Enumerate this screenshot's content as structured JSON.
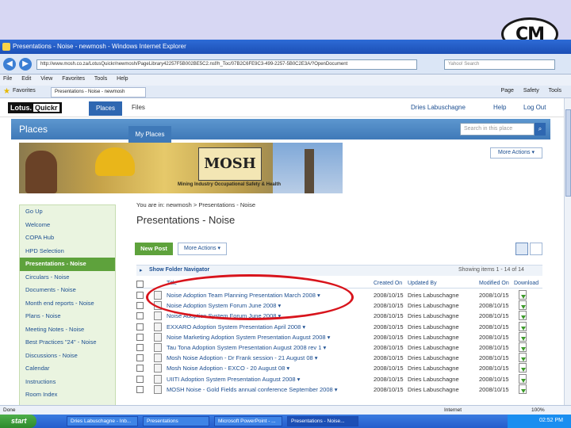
{
  "logo_text": "CM",
  "browser": {
    "title": "Presentations - Noise - newmosh - Windows Internet Explorer",
    "address": "http://www.mosh.co.za/LotusQuickr/newmosh/PageLibrary42257F5B002BE5C2.nsf/h_Toc/07B2C6FE9C3-499-2257-5B0C2E3A/?OpenDocument",
    "search_placeholder": "Yahoo! Search",
    "menu": [
      "File",
      "Edit",
      "View",
      "Favorites",
      "Tools",
      "Help"
    ],
    "favorites_label": "Favorites",
    "tab_label": "Presentations - Noise - newmosh",
    "tools": [
      "Page",
      "Safety",
      "Tools"
    ]
  },
  "quickr": {
    "logo_lotus": "Lotus.",
    "logo_quickr": "Quickr",
    "tab_places": "Places",
    "tab_files": "Files",
    "user": "Dries Labuschagne",
    "help": "Help",
    "logout": "Log Out",
    "places_title": "Places",
    "search_placeholder": "Search in this place",
    "myplaces_tab": "My Places",
    "banner_logo": "MOSH",
    "banner_caption": "Mining Industry Occupational Safety & Health",
    "more_actions_top": "More Actions ▾"
  },
  "sidebar": {
    "items": [
      {
        "label": "Go Up"
      },
      {
        "label": "Welcome"
      },
      {
        "label": "COPA Hub"
      },
      {
        "label": "HPD Selection"
      },
      {
        "label": "Presentations - Noise",
        "active": true
      },
      {
        "label": "Circulars - Noise"
      },
      {
        "label": "Documents - Noise"
      },
      {
        "label": "Month end reports - Noise"
      },
      {
        "label": "Plans - Noise"
      },
      {
        "label": "Meeting Notes - Noise"
      },
      {
        "label": "Best Practices \"24\" - Noise"
      },
      {
        "label": "Discussions - Noise"
      },
      {
        "label": "Calendar"
      },
      {
        "label": "Instructions"
      },
      {
        "label": "Room Index"
      }
    ]
  },
  "main": {
    "breadcrumb": "You are in: newmosh > Presentations - Noise",
    "title": "Presentations - Noise",
    "new_post": "New Post",
    "more_actions": "More Actions ▾",
    "folder_nav": "Show Folder Navigator",
    "showing_label": "Showing items",
    "showing_range": "1 - 14",
    "showing_of": "of",
    "showing_total": "14",
    "columns": {
      "title": "Title",
      "created": "Created On",
      "by": "Updated By",
      "modified": "Modified On",
      "download": "Download"
    },
    "rows": [
      {
        "title": "Noise Adoption Team Planning Presentation March 2008 ▾",
        "created": "2008/10/15",
        "by": "Dries Labuschagne",
        "modified": "2008/10/15"
      },
      {
        "title": "Noise Adoption System Forum June 2008 ▾",
        "created": "2008/10/15",
        "by": "Dries Labuschagne",
        "modified": "2008/10/15"
      },
      {
        "title": "Noise Adoption System Forum June 2008 ▾",
        "created": "2008/10/15",
        "by": "Dries Labuschagne",
        "modified": "2008/10/15"
      },
      {
        "title": "EXXARO Adoption System Presentation April 2008 ▾",
        "created": "2008/10/15",
        "by": "Dries Labuschagne",
        "modified": "2008/10/15"
      },
      {
        "title": "Noise Marketing Adoption System Presentation August 2008 ▾",
        "created": "2008/10/15",
        "by": "Dries Labuschagne",
        "modified": "2008/10/15"
      },
      {
        "title": "Tau Tona Adoption System Presentation August 2008 rev 1 ▾",
        "created": "2008/10/15",
        "by": "Dries Labuschagne",
        "modified": "2008/10/15"
      },
      {
        "title": "Mosh Noise Adoption - Dr Frank session - 21 August 08 ▾",
        "created": "2008/10/15",
        "by": "Dries Labuschagne",
        "modified": "2008/10/15"
      },
      {
        "title": "Mosh Noise Adoption - EXCO - 20 August 08 ▾",
        "created": "2008/10/15",
        "by": "Dries Labuschagne",
        "modified": "2008/10/15"
      },
      {
        "title": "UIITI Adoption System Presentation August 2008 ▾",
        "created": "2008/10/15",
        "by": "Dries Labuschagne",
        "modified": "2008/10/15"
      },
      {
        "title": "MOSH Noise - Gold Fields annual conference September 2008 ▾",
        "created": "2008/10/15",
        "by": "Dries Labuschagne",
        "modified": "2008/10/15"
      }
    ]
  },
  "statusbar": {
    "left": "Done",
    "zone": "Internet",
    "zoom": "100%"
  },
  "taskbar": {
    "start": "start",
    "items": [
      "Dries Labuschagne - Inb...",
      "Presentations",
      "Microsoft PowerPoint - ...",
      "Presentations - Noise..."
    ],
    "clock": "02:52 PM"
  }
}
